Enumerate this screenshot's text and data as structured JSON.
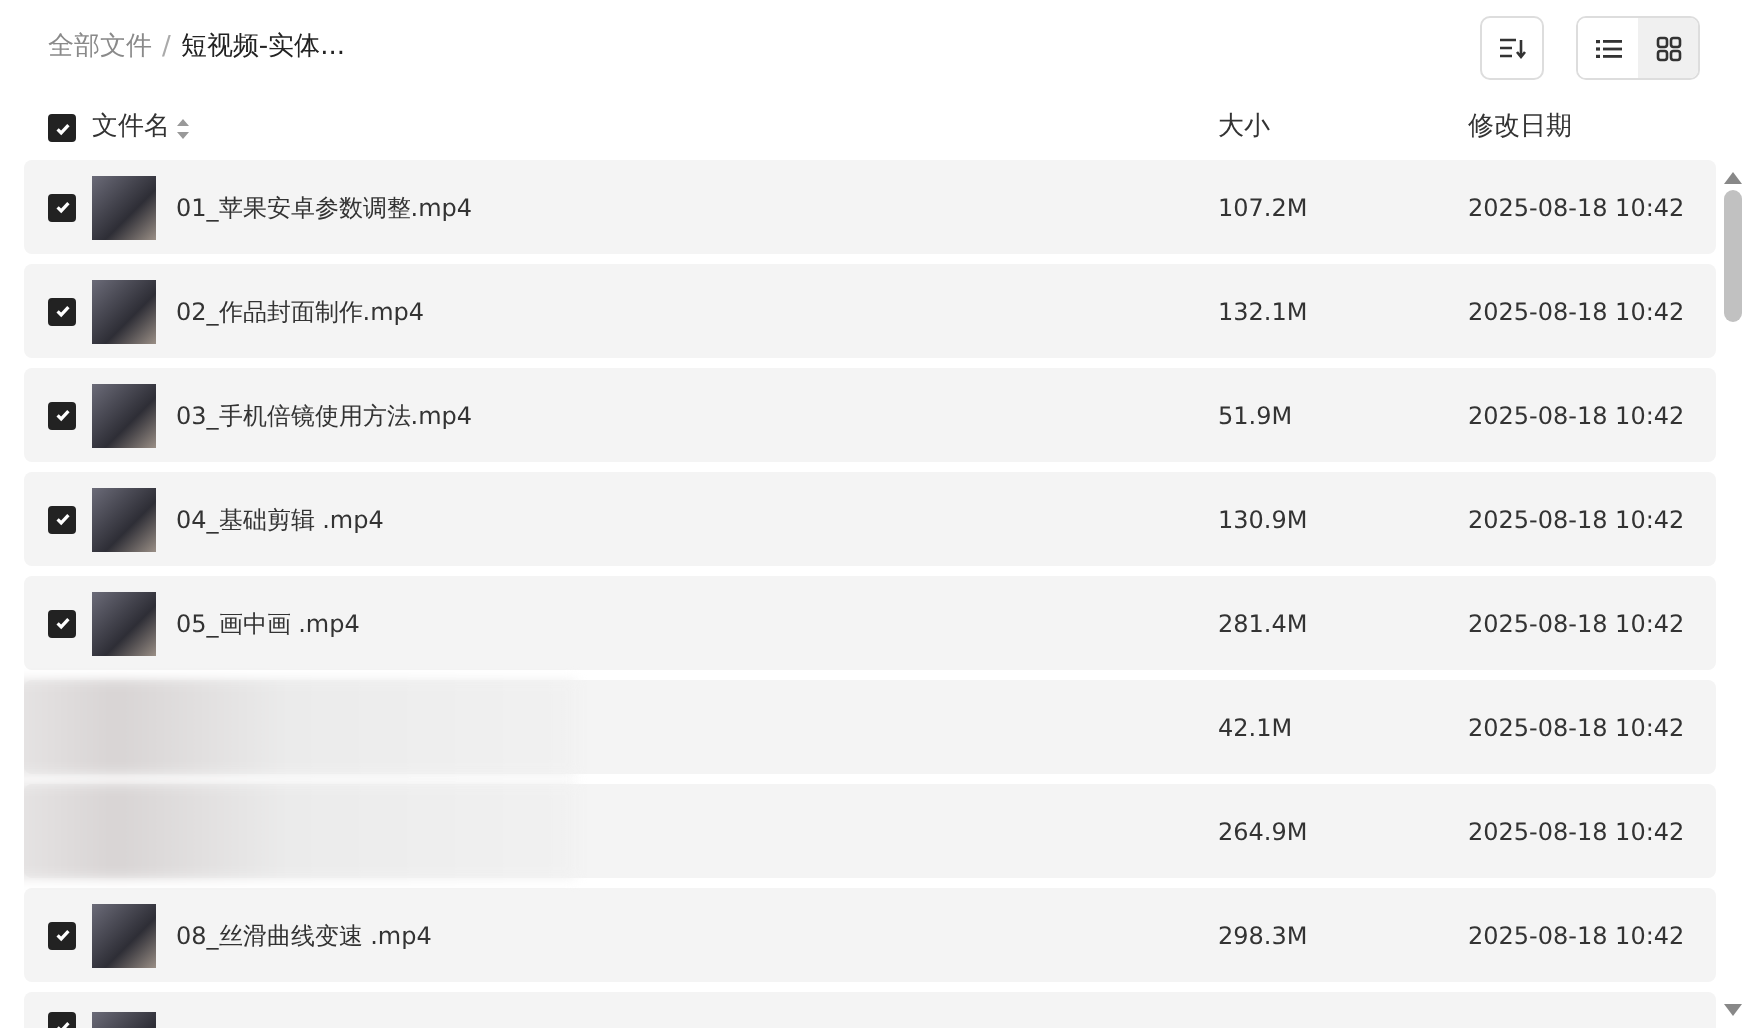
{
  "breadcrumb": [
    {
      "label": "全部文件",
      "current": false
    },
    {
      "separator": "/",
      "label": "短视频-实体...",
      "current": true
    }
  ],
  "toolbar": {
    "view_modes": [
      {
        "kind": "list",
        "selected": false
      },
      {
        "kind": "grid",
        "selected": true
      }
    ]
  },
  "table": {
    "select_all": {
      "checked": true
    },
    "columns": [
      "文件名",
      "大小",
      "修改日期"
    ],
    "rows": [
      {
        "kind": "file",
        "checked": true,
        "name": "01_苹果安卓参数调整.mp4",
        "size": "107.2M",
        "modified": "2025-08-18 10:42"
      },
      {
        "kind": "file",
        "checked": true,
        "name": "02_作品封面制作.mp4",
        "size": "132.1M",
        "modified": "2025-08-18 10:42"
      },
      {
        "kind": "file",
        "checked": true,
        "name": "03_手机倍镜使用方法.mp4",
        "size": "51.9M",
        "modified": "2025-08-18 10:42"
      },
      {
        "kind": "file",
        "checked": true,
        "name": "04_基础剪辑 .mp4",
        "size": "130.9M",
        "modified": "2025-08-18 10:42"
      },
      {
        "kind": "file",
        "checked": true,
        "name": "05_画中画 .mp4",
        "size": "281.4M",
        "modified": "2025-08-18 10:42"
      },
      {
        "kind": "obscured",
        "size": "42.1M",
        "modified": "2025-08-18 10:42"
      },
      {
        "kind": "obscured",
        "size": "264.9M",
        "modified": "2025-08-18 10:42"
      },
      {
        "kind": "file",
        "checked": true,
        "name": "08_丝滑曲线变速 .mp4",
        "size": "298.3M",
        "modified": "2025-08-18 10:42"
      },
      {
        "kind": "partial",
        "checked": true
      }
    ]
  }
}
